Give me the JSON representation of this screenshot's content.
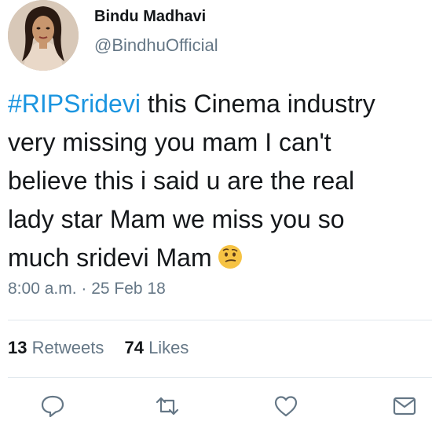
{
  "user": {
    "display_name": "Bindu Madhavi",
    "handle": "@BindhuOfficial",
    "avatar_icon": "profile-photo"
  },
  "tweet": {
    "hashtag": "#RIPSridevi",
    "lines": [
      " this Cinema industry",
      "very missing you mam I can't",
      "believe this i said u are the real",
      "lady star Mam we miss you so",
      "much sridevi Mam"
    ],
    "emoji": "thinking-face-emoji",
    "time": "8:00 a.m.",
    "separator": " · ",
    "date": "25 Feb 18"
  },
  "stats": {
    "retweets_count": "13",
    "retweets_label": "Retweets",
    "likes_count": "74",
    "likes_label": "Likes"
  },
  "actions": [
    {
      "name": "reply-icon"
    },
    {
      "name": "retweet-icon"
    },
    {
      "name": "like-icon"
    },
    {
      "name": "message-icon"
    }
  ],
  "colors": {
    "hashtag": "#1b95e0",
    "secondary_text": "#657786",
    "primary_text": "#14171a",
    "divider": "#e1e8ed",
    "emoji": "#f6c344"
  }
}
